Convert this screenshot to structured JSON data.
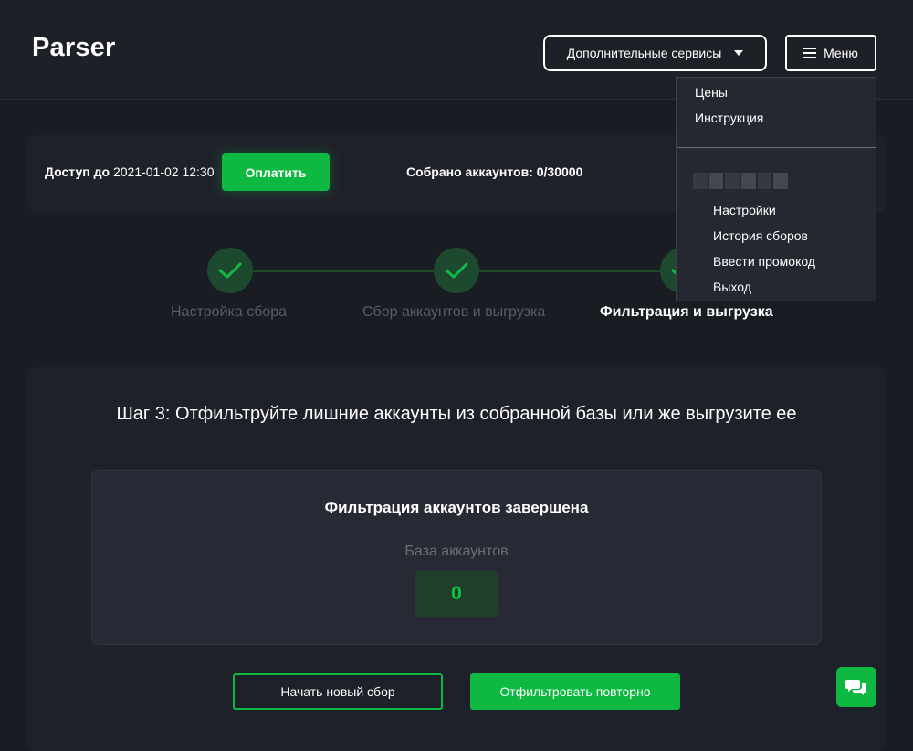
{
  "app": {
    "title": "Parser"
  },
  "header": {
    "services_label": "Дополнительные сервисы",
    "menu_label": "Меню"
  },
  "menu": {
    "items": [
      "Цены",
      "Инструкция"
    ],
    "user_items": [
      "Настройки",
      "История сборов",
      "Ввести промокод",
      "Выход"
    ]
  },
  "access": {
    "label": "Доступ до",
    "date": "2021-01-02 12:30",
    "pay_label": "Оплатить",
    "collected": "Собрано аккаунтов: 0/30000"
  },
  "steps": [
    {
      "label": "Настройка сбора",
      "state": "done"
    },
    {
      "label": "Сбор аккаунтов и выгрузка",
      "state": "done"
    },
    {
      "label": "Фильтрация и выгрузка",
      "state": "active"
    }
  ],
  "main": {
    "title": "Шаг 3: Отфильтруйте лишние аккаунты из собранной базы или же выгрузите ее",
    "result_title": "Фильтрация аккаунтов завершена",
    "db_label": "База аккаунтов",
    "db_count": "0",
    "new_label": "Начать новый сбор",
    "refilter_label": "Отфильтровать повторно"
  },
  "colors": {
    "accent": "#0db941",
    "background": "#1a1c23",
    "card": "#1f212a",
    "step_done": "#1d4a2e"
  },
  "icons": {
    "services_caret": "caret-down-icon",
    "menu": "hamburger-icon",
    "step_done": "check-icon",
    "chat": "chat-icon"
  }
}
